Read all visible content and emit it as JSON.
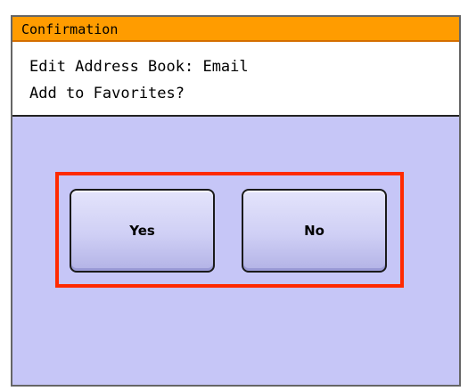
{
  "dialog": {
    "title": "Confirmation",
    "message_lines": [
      "Edit Address Book: Email",
      "Add to Favorites?"
    ],
    "buttons": {
      "yes_label": "Yes",
      "no_label": "No"
    }
  },
  "colors": {
    "title_bar": "#ff9c00",
    "panel_background": "#c6c6f7",
    "message_background": "#ffffff",
    "highlight_border": "#ff2a00"
  }
}
